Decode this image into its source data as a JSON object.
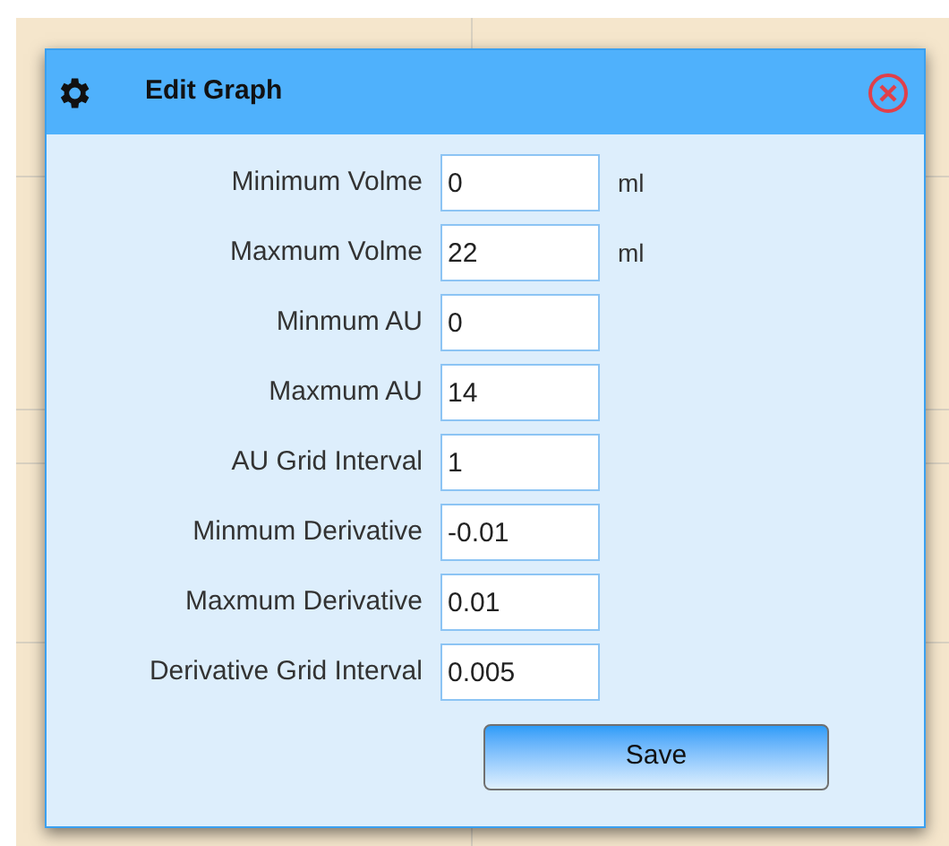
{
  "dialog": {
    "title": "Edit Graph",
    "fields": [
      {
        "label": "Minimum Volme",
        "value": "0",
        "unit": "ml"
      },
      {
        "label": "Maxmum Volme",
        "value": "22",
        "unit": "ml"
      },
      {
        "label": "Minmum AU",
        "value": "0"
      },
      {
        "label": "Maxmum AU",
        "value": "14"
      },
      {
        "label": "AU Grid Interval",
        "value": "1"
      },
      {
        "label": "Minmum Derivative",
        "value": "-0.01"
      },
      {
        "label": "Maxmum Derivative",
        "value": "0.01"
      },
      {
        "label": "Derivative Grid Interval",
        "value": "0.005"
      }
    ],
    "save_button": "Save"
  }
}
